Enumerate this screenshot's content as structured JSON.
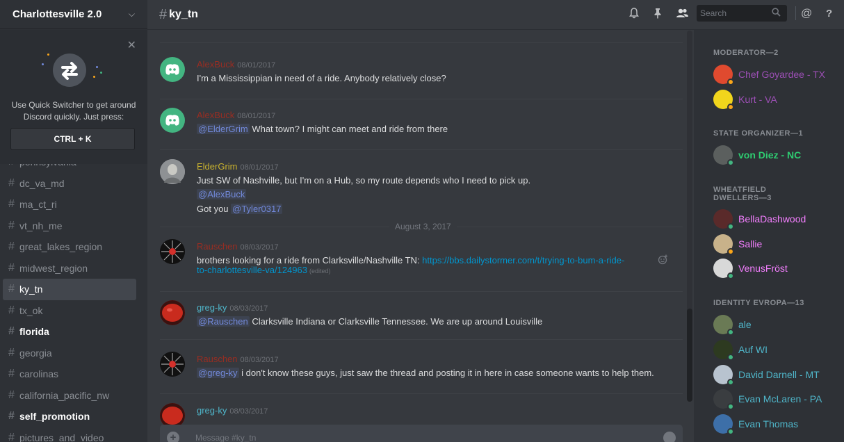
{
  "guild": {
    "name": "Charlottesville 2.0"
  },
  "quick_switcher": {
    "text_line1": "Use Quick Switcher to get around",
    "text_line2": "Discord quickly. Just press:",
    "shortcut": "CTRL + K"
  },
  "channels": [
    {
      "name": "pennsylvania",
      "style": "normal"
    },
    {
      "name": "dc_va_md",
      "style": "normal"
    },
    {
      "name": "ma_ct_ri",
      "style": "normal"
    },
    {
      "name": "vt_nh_me",
      "style": "normal"
    },
    {
      "name": "great_lakes_region",
      "style": "normal"
    },
    {
      "name": "midwest_region",
      "style": "normal"
    },
    {
      "name": "ky_tn",
      "style": "active"
    },
    {
      "name": "tx_ok",
      "style": "normal"
    },
    {
      "name": "florida",
      "style": "bold"
    },
    {
      "name": "georgia",
      "style": "normal"
    },
    {
      "name": "carolinas",
      "style": "normal"
    },
    {
      "name": "california_pacific_nw",
      "style": "normal"
    },
    {
      "name": "self_promotion",
      "style": "bold"
    },
    {
      "name": "pictures_and_video",
      "style": "normal"
    }
  ],
  "header": {
    "channel_name": "ky_tn",
    "search_placeholder": "Search"
  },
  "messages": [
    {
      "author": "AlexBuck",
      "time": "08/01/2017",
      "lines": [
        "I'm a Mississippian in need of a ride. Anybody relatively close?"
      ]
    },
    {
      "author": "AlexBuck",
      "time": "08/01/2017",
      "mention": "@ElderGrim",
      "text": " What town? I might can meet and ride from there"
    },
    {
      "author": "ElderGrim",
      "time": "08/01/2017",
      "line1": "Just SW of Nashville, but I'm on a Hub, so my route depends who I need to pick up.",
      "line2_mention": "@AlexBuck",
      "line3_text": "Got you ",
      "line3_mention": "@Tyler0317"
    },
    {
      "author": "Rauschen",
      "time": "08/03/2017",
      "text": "brothers looking for a ride from Clarksville/Nashville TN: ",
      "link1": "https://bbs.dailystormer.com/t/trying-to-bum-a-ride-",
      "link2": "to-charlottesville-va/124963",
      "edited": "(edited)"
    },
    {
      "author": "greg-ky",
      "time": "08/03/2017",
      "mention": "@Rauschen",
      "text": " Clarksville Indiana or Clarksville Tennessee. We are up around Louisville"
    },
    {
      "author": "Rauschen",
      "time": "08/03/2017",
      "mention": "@greg-ky",
      "text": "  i don't know these guys, just saw the thread and posting it in here in case someone wants to help them."
    },
    {
      "author": "greg-ky",
      "time": "08/03/2017"
    }
  ],
  "date_divider": "August 3, 2017",
  "composer": {
    "placeholder": "Message #ky_tn"
  },
  "member_list": {
    "moderator": {
      "heading": "MODERATOR—2",
      "members": [
        "Chef Goyardee - TX",
        "Kurt - VA"
      ]
    },
    "state_organizer": {
      "heading": "STATE ORGANIZER—1",
      "members": [
        "von Diez - NC"
      ]
    },
    "wheatfield": {
      "heading_line1": "WHEATFIELD",
      "heading_line2": "DWELLERS—3",
      "members": [
        "BellaDashwood",
        "Sallie",
        "VenusFröst"
      ]
    },
    "identity": {
      "heading": "IDENTITY EVROPA—13",
      "members": [
        "ale",
        "Auf WI",
        "David Darnell - MT",
        "Evan McLaren - PA",
        "Evan Thomas"
      ]
    }
  },
  "colors": {
    "online": "#43b581",
    "idle": "#faa61a",
    "moderator": "#9c4fb5",
    "state_organizer": "#2ecc71",
    "wheatfield": "#f47fff",
    "identity": "#4fb5c9",
    "rauschen": "#992d22",
    "eldergrim": "#c9b22e",
    "gregky": "#4fb5c9",
    "mention": "#7289da",
    "link": "#0096cf"
  }
}
